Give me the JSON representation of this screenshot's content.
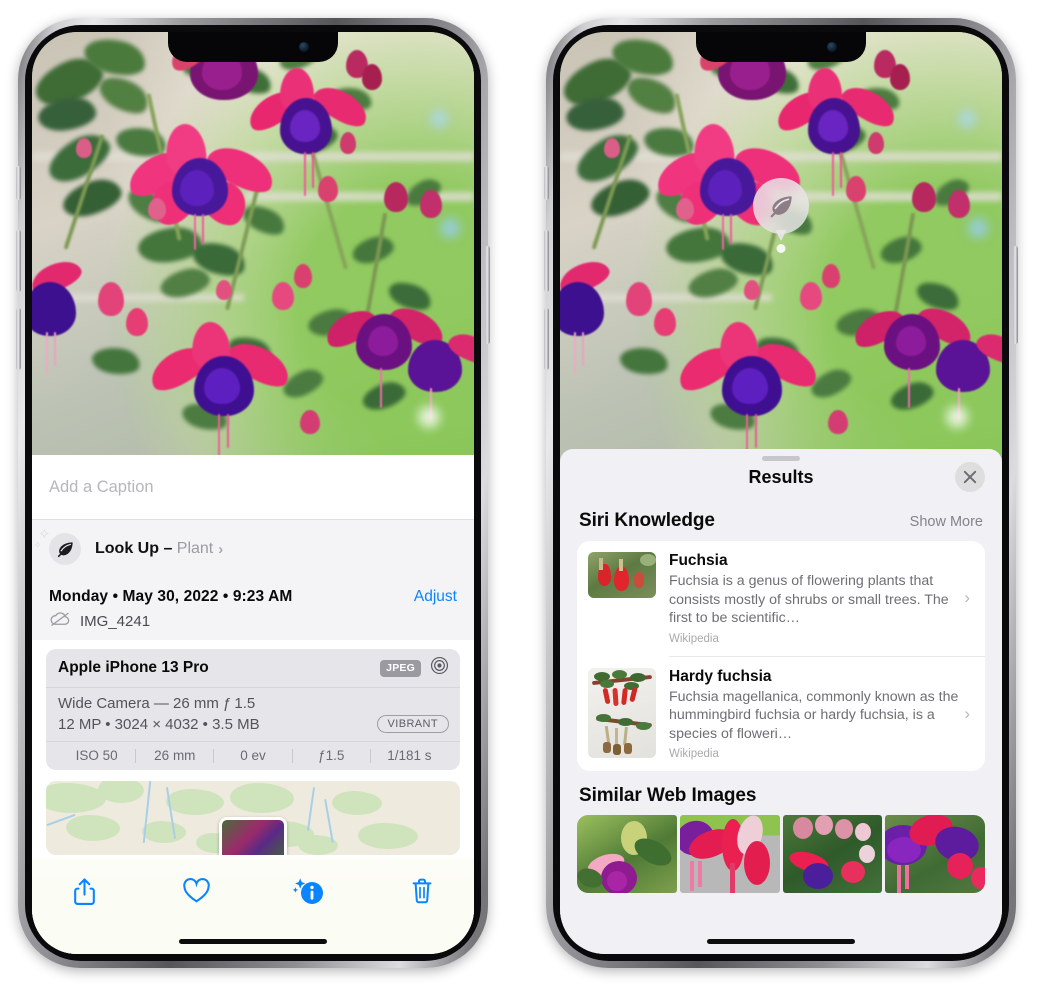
{
  "left_phone": {
    "caption_field": {
      "placeholder": "Add a Caption",
      "value": ""
    },
    "look_up": {
      "label": "Look Up – ",
      "subject": "Plant",
      "chevron": "›",
      "icon": "leaf-icon"
    },
    "metadata": {
      "date_line": "Monday • May 30, 2022 • 9:23 AM",
      "adjust_label": "Adjust",
      "filename": "IMG_4241",
      "cloud_icon": "icloud-slash-icon"
    },
    "camera_card": {
      "device": "Apple iPhone 13 Pro",
      "format_badge": "JPEG",
      "aperture_icon": "aperture-icon",
      "lens": "Wide Camera — 26 mm ƒ 1.5",
      "dimensions": "12 MP • 3024 × 4032 • 3.5 MB",
      "style_badge": "VIBRANT",
      "exif": [
        "ISO 50",
        "26 mm",
        "0 ev",
        "ƒ1.5",
        "1/181 s"
      ]
    },
    "toolbar": {
      "share_label": "share-icon",
      "favorite_label": "heart-icon",
      "info_label": "info-sparkle-icon",
      "delete_label": "trash-icon"
    }
  },
  "right_phone": {
    "visual_lookup_badge": {
      "icon": "leaf-icon"
    },
    "sheet": {
      "title": "Results",
      "close_label": "✕",
      "sections": [
        {
          "title": "Siri Knowledge",
          "action": "Show More",
          "items": [
            {
              "title": "Fuchsia",
              "description": "Fuchsia is a genus of flowering plants that consists mostly of shrubs or small trees. The first to be scientific…",
              "source": "Wikipedia",
              "chevron": "›"
            },
            {
              "title": "Hardy fuchsia",
              "description": "Fuchsia magellanica, commonly known as the hummingbird fuchsia or hardy fuchsia, is a species of floweri…",
              "source": "Wikipedia",
              "chevron": "›"
            }
          ]
        },
        {
          "title": "Similar Web Images",
          "tiles": [
            "web-image-1",
            "web-image-2",
            "web-image-3",
            "web-image-4"
          ]
        }
      ]
    }
  },
  "colors": {
    "accent_blue": "#0a84ff",
    "sheet_bg": "#f1f0f5",
    "card_bg": "#ffffff",
    "secondary_text": "#6e6e75",
    "tertiary_text": "#a9a9af"
  }
}
